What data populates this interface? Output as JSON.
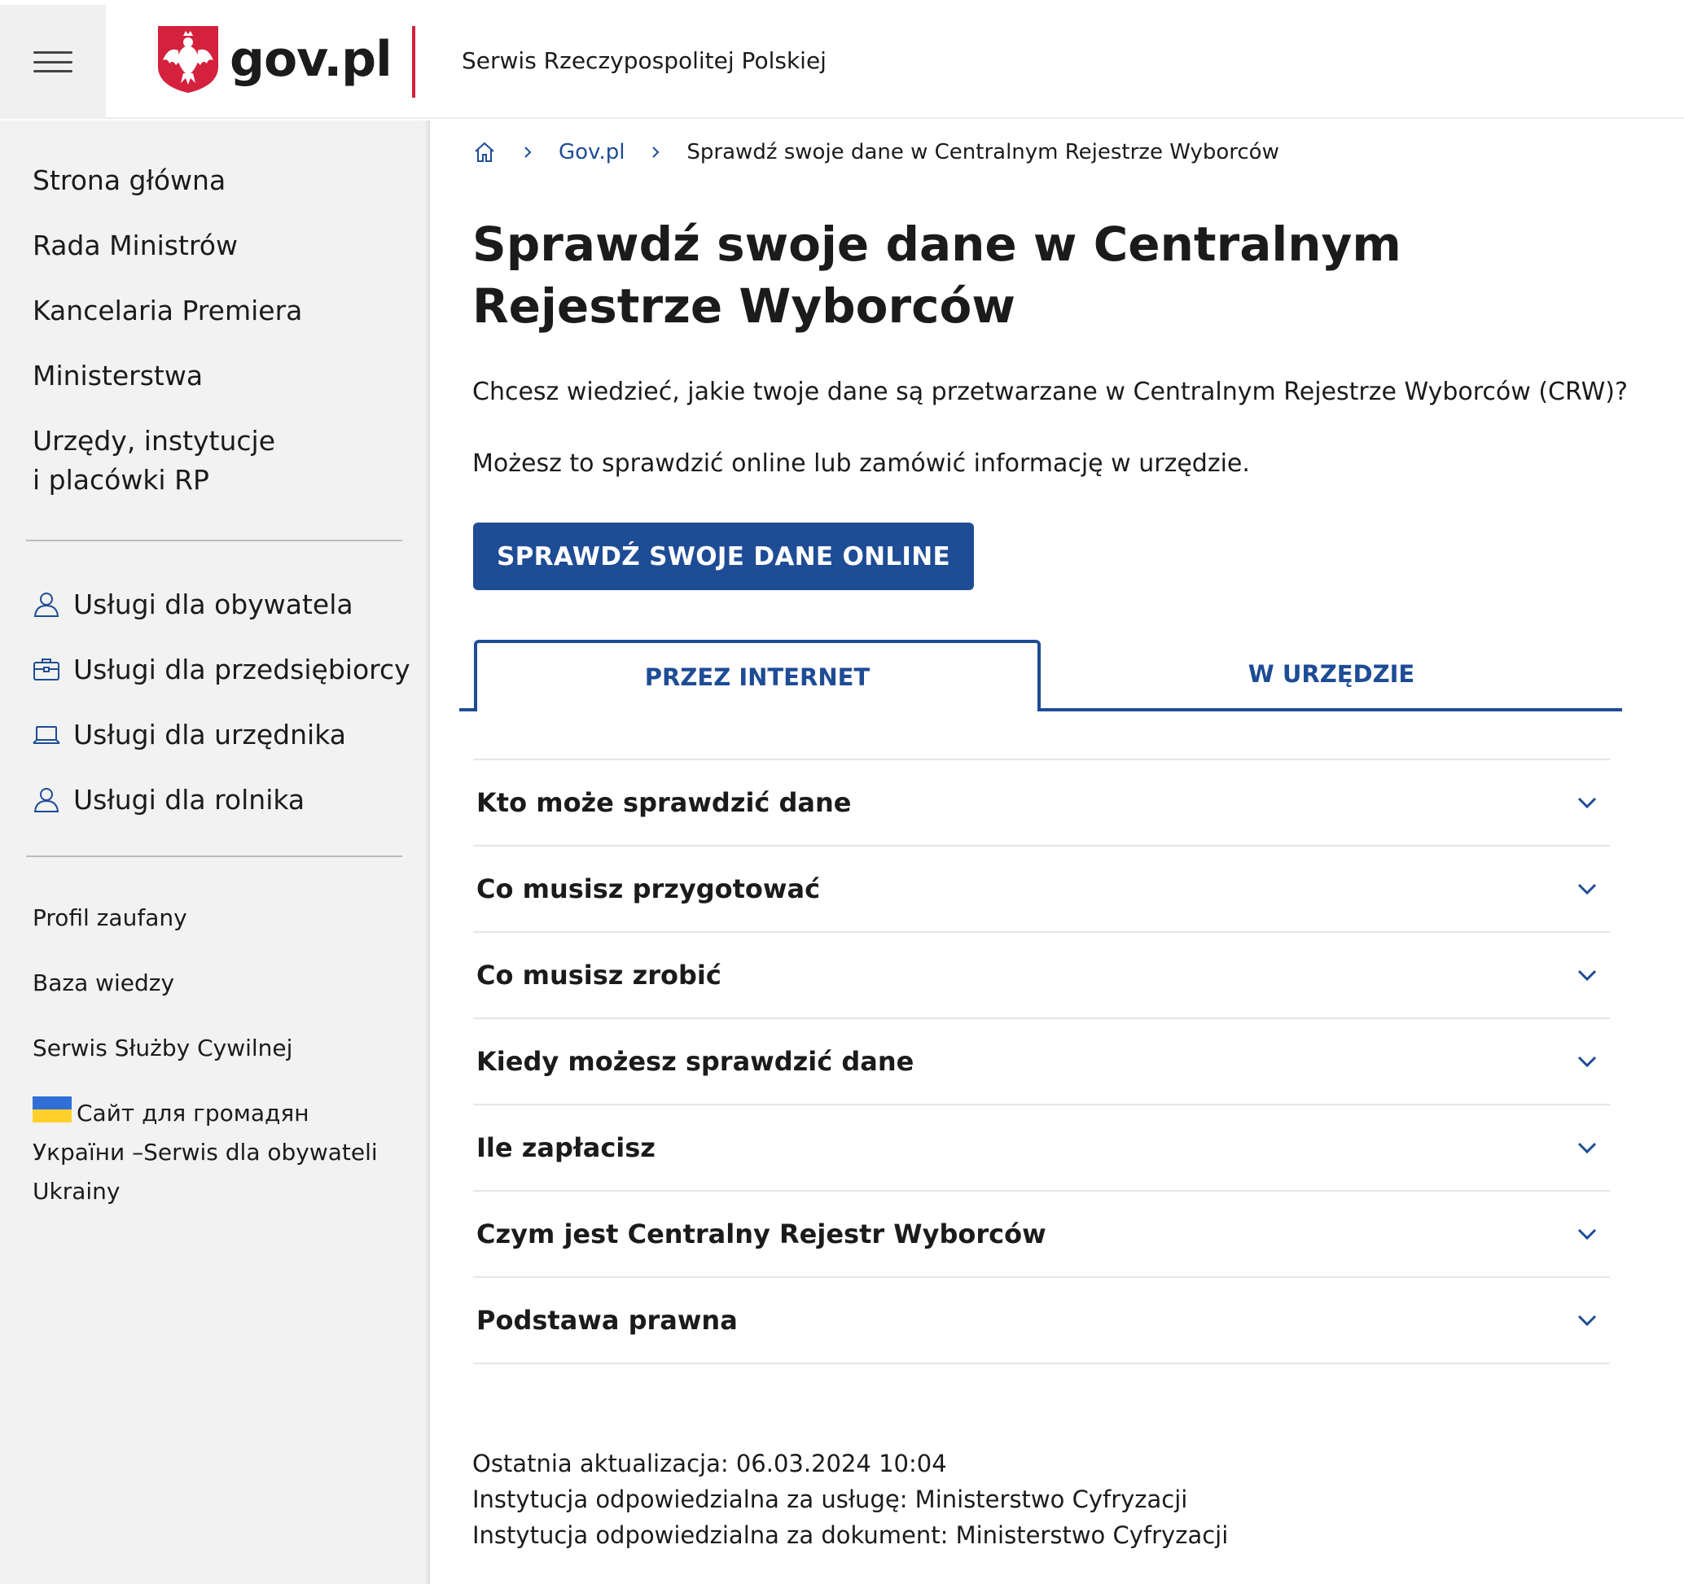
{
  "header": {
    "logo_text": "gov.pl",
    "subtitle": "Serwis Rzeczypospolitej Polskiej"
  },
  "sidebar": {
    "main_items": [
      {
        "label": "Strona główna"
      },
      {
        "label": "Rada Ministrów"
      },
      {
        "label": "Kancelaria Premiera"
      },
      {
        "label": "Ministerstwa"
      },
      {
        "label": "Urzędy, instytucje i placówki RP"
      }
    ],
    "services": [
      {
        "label": "Usługi dla obywatela",
        "icon": "person-icon"
      },
      {
        "label": "Usługi dla przedsiębiorcy",
        "icon": "briefcase-icon"
      },
      {
        "label": "Usługi dla urzędnika",
        "icon": "laptop-icon"
      },
      {
        "label": "Usługi dla rolnika",
        "icon": "person-icon"
      }
    ],
    "links": [
      {
        "label": "Profil zaufany"
      },
      {
        "label": "Baza wiedzy"
      },
      {
        "label": "Serwis Służby Cywilnej"
      }
    ],
    "ukraine_link": "Сайт для громадян України –Serwis dla obywateli Ukrainy"
  },
  "breadcrumb": {
    "home_icon": "home-icon",
    "link": "Gov.pl",
    "current": "Sprawdź swoje dane w Centralnym Rejestrze Wyborców"
  },
  "main": {
    "title": "Sprawdź swoje dane w Centralnym Rejestrze Wyborców",
    "intro": "Chcesz wiedzieć, jakie twoje dane są przetwarzane w Centralnym Rejestrze Wyborców (CRW)?",
    "intro2": "Możesz to sprawdzić online lub zamówić informację w urzędzie.",
    "cta_label": "SPRAWDŹ SWOJE DANE ONLINE",
    "tabs": [
      {
        "label": "PRZEZ INTERNET",
        "active": true
      },
      {
        "label": "W URZĘDZIE",
        "active": false
      }
    ],
    "accordion": [
      {
        "title": "Kto może sprawdzić dane"
      },
      {
        "title": "Co musisz przygotować"
      },
      {
        "title": "Co musisz zrobić"
      },
      {
        "title": "Kiedy możesz sprawdzić dane"
      },
      {
        "title": "Ile zapłacisz"
      },
      {
        "title": "Czym jest Centralny Rejestr Wyborców"
      },
      {
        "title": "Podstawa prawna"
      }
    ],
    "meta": {
      "updated": "Ostatnia aktualizacja: 06.03.2024 10:04",
      "service_institution": "Instytucja odpowiedzialna za usługę: Ministerstwo Cyfryzacji",
      "document_institution": "Instytucja odpowiedzialna za dokument: Ministerstwo Cyfryzacji"
    }
  },
  "colors": {
    "primary": "#1e4c95",
    "accent_red": "#d4213d",
    "sidebar_bg": "#f2f2f2"
  }
}
